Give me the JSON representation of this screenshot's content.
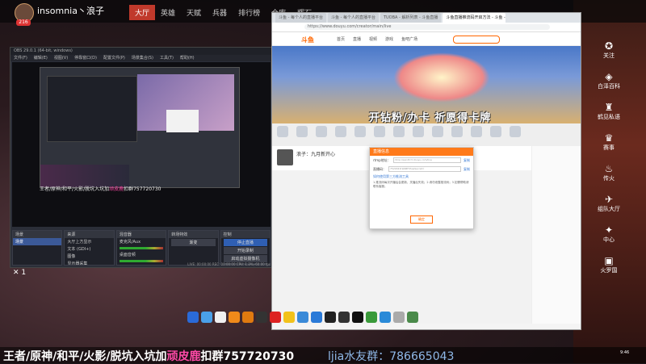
{
  "header": {
    "streamer": "insomnia丶浪子",
    "level": "216",
    "tabs": [
      "大厅",
      "英雄",
      "天赋",
      "兵器",
      "排行榜",
      "仓库",
      "辉石"
    ]
  },
  "obs": {
    "title": "OBS 29.0.1 (64-bit, windows)",
    "menu": [
      "文件(F)",
      "编辑(E)",
      "视图(V)",
      "停靠窗口(D)",
      "配置文件(P)",
      "场景集合(S)",
      "工具(T)",
      "帮助(H)"
    ],
    "preview_caption": "王者/原神/和平/火影/脱坑入坑加",
    "preview_caption_highlight": "顽皮鹿",
    "preview_caption_tail": "扣群757720730",
    "docks": {
      "scenes_title": "场景",
      "scenes": [
        "场景"
      ],
      "sources_title": "来源",
      "sources": [
        "大厅上方显示",
        "文本 (GDI+)",
        "图像",
        "显示器采集"
      ],
      "mixer_title": "混音器",
      "mixer": [
        "麦克风/Aux",
        "桌面音频"
      ],
      "transitions_title": "转场特效",
      "transition_value": "渐变",
      "controls_title": "控制",
      "controls": [
        "停止直播",
        "开始录制",
        "启动虚拟摄像机",
        "工作室模式",
        "设置",
        "退出"
      ]
    },
    "status": "LIVE: 00:00:00   REC: 00:00:00   CPU: 1.2%, 60.00 fps"
  },
  "x_count": "✕ 1",
  "browser": {
    "tabs": [
      "斗鱼 - 每个人的直播平台",
      "斗鱼 - 每个人的直播平台",
      "TUOBA - 解析列表 - 斗鱼直播",
      "斗鱼直播推流码开启方法 - 斗鱼 - 每个人的直播平台"
    ],
    "url": "https://www.douyu.com/creator/main/live",
    "site_logo": "斗鱼",
    "site_links": [
      "首页",
      "直播",
      "视频",
      "游戏",
      "鱼吧广场"
    ],
    "banner_text": "开钻粉/办卡 祈愿得卡牌",
    "room_name": "浪子：九月新开心",
    "modal": {
      "title": "直播信息",
      "rtmp_label": "rtmp地址：",
      "rtmp_value": "rtmp://sendtc3.douyu.com/live",
      "rtmp_copy": "复制",
      "key_label": "直播码：",
      "key_value": "7520343rWzBFlI?wsSecret=",
      "key_copy": "复制",
      "link_text": "如何使用第三方推流工具",
      "note": "1.推流码每次开播后会更新，关播后失效；2.请勿泄露推流码；3.如需帮助请联系客服。",
      "button": "确定"
    }
  },
  "right_menu": [
    {
      "icon": "✪",
      "label": "关注"
    },
    {
      "icon": "◈",
      "label": "白泽百科"
    },
    {
      "icon": "♜",
      "label": "鹤见私语"
    },
    {
      "icon": "♛",
      "label": "赛事"
    },
    {
      "icon": "♨",
      "label": "传火"
    },
    {
      "icon": "✈",
      "label": "组队大厅"
    },
    {
      "icon": "✦",
      "label": "中心"
    },
    {
      "icon": "▣",
      "label": "火罗国"
    }
  ],
  "dock_icons": [
    {
      "name": "taskview-icon",
      "color": "#2a6ad8"
    },
    {
      "name": "rocket-icon",
      "color": "#4aa0e8"
    },
    {
      "name": "calendar-icon",
      "color": "#f0f0f0"
    },
    {
      "name": "app-orange-icon",
      "color": "#f08a1a"
    },
    {
      "name": "app-orange2-icon",
      "color": "#e07a10"
    },
    {
      "name": "clock-icon",
      "color": "#333"
    },
    {
      "name": "app-red-icon",
      "color": "#d22"
    },
    {
      "name": "app-yellow-icon",
      "color": "#f2c21a"
    },
    {
      "name": "app-blue-icon",
      "color": "#3a8ad8"
    },
    {
      "name": "k-icon",
      "color": "#2a7ad8"
    },
    {
      "name": "app-black-icon",
      "color": "#222"
    },
    {
      "name": "obs-icon",
      "color": "#333"
    },
    {
      "name": "qq-icon",
      "color": "#111"
    },
    {
      "name": "app-green-icon",
      "color": "#3a9a3a"
    },
    {
      "name": "edge-icon",
      "color": "#2a8ad8"
    },
    {
      "name": "app-grey-icon",
      "color": "#aaa"
    },
    {
      "name": "app-green2-icon",
      "color": "#4a8a4a"
    }
  ],
  "bottom": {
    "banner_left": "王者/原神/和平/火影/脱坑入坑加",
    "banner_pink": "顽皮鹿",
    "banner_tail": "扣群757720730",
    "banner_right": "ljia水友群：786665043",
    "clock": "9:46"
  }
}
